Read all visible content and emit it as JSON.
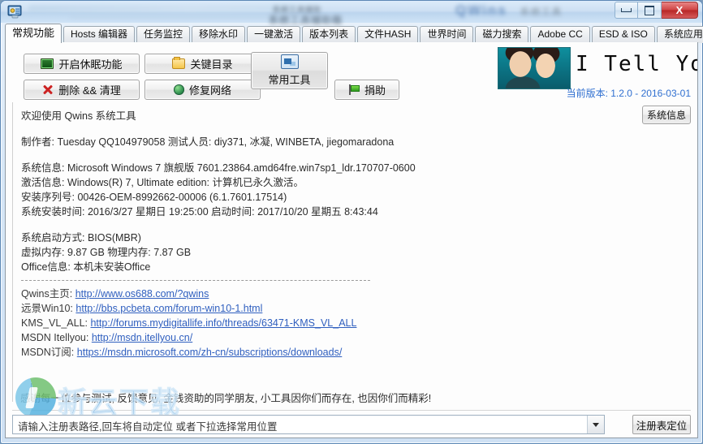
{
  "window": {
    "title_blurred_1": "系统工具辅助",
    "title_blurred_2": "系统工具辅助箱",
    "title_blurred_3": "QWins",
    "title_blurred_4": "系统工具",
    "icon": "app-monitor-icon",
    "controls": {
      "minimize": "minimize-icon",
      "maximize": "maximize-icon",
      "close": "X"
    }
  },
  "tabs": [
    {
      "label": "常规功能",
      "selected": true
    },
    {
      "label": "Hosts 编辑器",
      "selected": false
    },
    {
      "label": "任务监控",
      "selected": false
    },
    {
      "label": "移除水印",
      "selected": false
    },
    {
      "label": "一键激活",
      "selected": false
    },
    {
      "label": "版本列表",
      "selected": false
    },
    {
      "label": "文件HASH",
      "selected": false
    },
    {
      "label": "世界时间",
      "selected": false
    },
    {
      "label": "磁力搜索",
      "selected": false
    },
    {
      "label": "Adobe CC",
      "selected": false
    },
    {
      "label": "ESD & ISO",
      "selected": false
    },
    {
      "label": "系统应用",
      "selected": false
    }
  ],
  "buttons": {
    "sleep": "开启休眠功能",
    "clean": "删除 && 清理",
    "key_dir": "关键目录",
    "fix_net": "修复网络",
    "tools": "常用工具",
    "donate": "捐助",
    "sysinfo": "系统信息",
    "registry_locate": "注册表定位"
  },
  "banner": {
    "brand": "I Tell You",
    "version": "当前版本: 1.2.0 - 2016-03-01"
  },
  "info": {
    "welcome": "欢迎使用 Qwins 系统工具",
    "author": "制作者: Tuesday QQ104979058 测试人员: diy371, 冰凝, WINBETA, jiegomaradona",
    "sys_info": "系统信息: Microsoft Windows 7 旗舰版  7601.23864.amd64fre.win7sp1_ldr.170707-0600",
    "activation": "激活信息: Windows(R) 7, Ultimate edition:  计算机已永久激活。",
    "serial": "安装序列号: 00426-OEM-8992662-00006 (6.1.7601.17514)",
    "install_time": "系统安装时间: 2016/3/27 星期日 19:25:00 启动时间: 2017/10/20 星期五 8:43:44",
    "boot_mode": "系统启动方式: BIOS(MBR)",
    "memory": "虚拟内存: 9.87 GB 物理内存: 7.87 GB",
    "office": "Office信息: 本机未安装Office"
  },
  "links": [
    {
      "label": "Qwins主页:",
      "url": "http://www.os688.com/?qwins"
    },
    {
      "label": "远景Win10:",
      "url": "http://bbs.pcbeta.com/forum-win10-1.html"
    },
    {
      "label": "KMS_VL_ALL:",
      "url": "http://forums.mydigitallife.info/threads/63471-KMS_VL_ALL"
    },
    {
      "label": "MSDN Itellyou:",
      "url": "http://msdn.itellyou.cn/"
    },
    {
      "label": "MSDN订阅:",
      "url": "https://msdn.microsoft.com/zh-cn/subscriptions/downloads/"
    }
  ],
  "thanks": "感谢每一位参与测试, 反馈意见, 金钱资助的同学朋友, 小工具因你们而存在, 也因你们而精彩!",
  "registry_combo": {
    "placeholder": "请输入注册表路径,回车将自动定位 或者下拉选择常用位置",
    "value": ""
  },
  "watermark": {
    "text": "新云下载"
  },
  "colors": {
    "accent": "#2f5fbf",
    "version": "#2f6fd0",
    "close": "#b72626",
    "watermark": "#7fb8e6"
  }
}
